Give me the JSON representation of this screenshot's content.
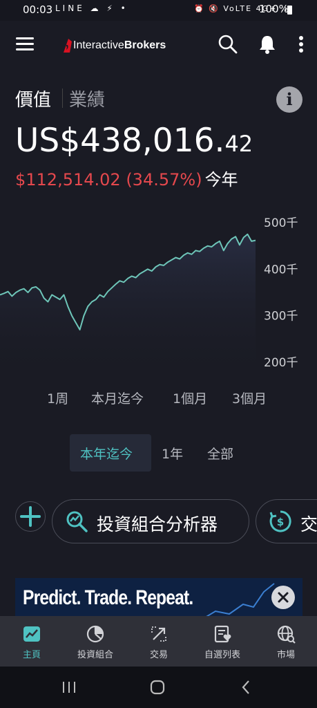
{
  "status_bar": {
    "time": "00:03",
    "left_icons": "LINE ☁ ⚡ •",
    "right_icons": "⏰ 🔇 VoLTE 4G+ .ıl",
    "battery": "100%"
  },
  "app_bar": {
    "brand_light": "Interactive",
    "brand_bold": "Brokers",
    "icons": [
      "menu-icon",
      "search-icon",
      "bell-icon",
      "more-vertical-icon"
    ]
  },
  "tabs": {
    "active": "價值",
    "inactive": "業績"
  },
  "info_label": "i",
  "portfolio": {
    "value_main": "US$438,016.",
    "value_cents": "42",
    "change": "$112,514.02 (34.57%)",
    "period": "今年"
  },
  "chart_data": {
    "type": "line",
    "y_ticks": [
      "500千",
      "400千",
      "300千",
      "200千"
    ],
    "ylim": [
      200000,
      500000
    ],
    "x_range": [
      "start of year",
      "today"
    ],
    "series": [
      {
        "values": [
          345000,
          348000,
          352000,
          342000,
          350000,
          355000,
          358000,
          350000,
          360000,
          362000,
          355000,
          338000,
          330000,
          345000,
          340000,
          335000,
          345000,
          320000,
          300000,
          285000,
          270000,
          300000,
          320000,
          330000,
          335000,
          345000,
          340000,
          352000,
          360000,
          368000,
          375000,
          372000,
          380000,
          385000,
          382000,
          390000,
          395000,
          400000,
          396000,
          405000,
          410000,
          408000,
          415000,
          420000,
          425000,
          422000,
          430000,
          435000,
          432000,
          440000,
          438000,
          445000,
          450000,
          448000,
          455000,
          460000,
          440000,
          455000,
          465000,
          470000,
          452000,
          468000,
          475000,
          460000,
          462000
        ]
      }
    ],
    "line_color": "#6ec6b9"
  },
  "ranges_row1": [
    "1周",
    "本月迄今",
    "1個月",
    "3個月"
  ],
  "ranges_row2": [
    "本年迄今",
    "1年",
    "全部"
  ],
  "actions": {
    "plus": "+",
    "analyzer": "投資組合分析器",
    "trade_partial": "交"
  },
  "banner": {
    "text": "Predict. Trade. Repeat."
  },
  "bottom_nav": [
    {
      "label": "主頁",
      "icon": "home-chart-icon",
      "active": true
    },
    {
      "label": "投資組合",
      "icon": "portfolio-pie-icon",
      "active": false
    },
    {
      "label": "交易",
      "icon": "trade-arrows-icon",
      "active": false
    },
    {
      "label": "自選列表",
      "icon": "watchlist-heart-icon",
      "active": false
    },
    {
      "label": "市場",
      "icon": "market-globe-icon",
      "active": false
    }
  ],
  "colors": {
    "accent": "#4fc2c2",
    "loss_gain_red": "#e5484d",
    "background": "#1a1b24"
  }
}
